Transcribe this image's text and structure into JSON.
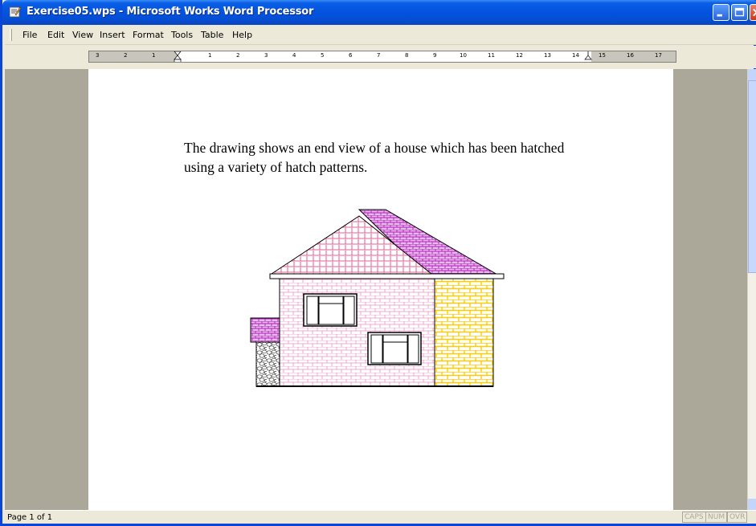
{
  "window": {
    "title": "Exercise05.wps - Microsoft Works Word Processor",
    "title_color": "#0555e0"
  },
  "menu": [
    {
      "label": "File"
    },
    {
      "label": "Edit"
    },
    {
      "label": "View"
    },
    {
      "label": "Insert"
    },
    {
      "label": "Format"
    },
    {
      "label": "Tools"
    },
    {
      "label": "Table"
    },
    {
      "label": "Help"
    }
  ],
  "ruler": {
    "numbers": [
      "3",
      "2",
      "1",
      "1",
      "2",
      "3",
      "4",
      "5",
      "6",
      "7",
      "8",
      "9",
      "10",
      "11",
      "12",
      "13",
      "14",
      "15",
      "16",
      "17"
    ]
  },
  "document": {
    "paragraph": "The drawing shows an end view of a house which has been hatched using a variety of hatch patterns.",
    "colors": {
      "roof_left": "#e0207a",
      "roof_right": "#c020c0",
      "wall_pink": "#f0a0c8",
      "wall_yellow": "#ffd000",
      "stone": "#606060"
    }
  },
  "status": {
    "page": "Page 1 of 1",
    "indicators": [
      "CAPS",
      "NUM",
      "OVR"
    ]
  }
}
